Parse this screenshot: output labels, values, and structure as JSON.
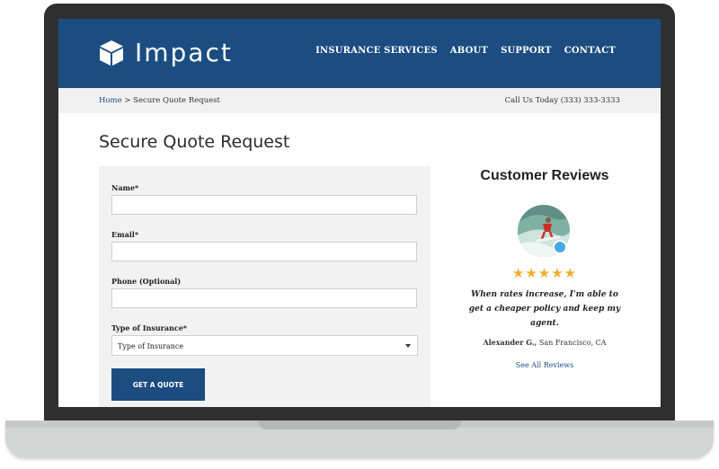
{
  "brand": {
    "name": "Impact"
  },
  "nav": {
    "items": [
      "INSURANCE SERVICES",
      "ABOUT",
      "SUPPORT",
      "CONTACT"
    ]
  },
  "breadcrumb": {
    "home": "Home",
    "separator": ">",
    "current": "Secure Quote Request"
  },
  "contact": {
    "phone_text": "Call Us Today (333) 333-3333"
  },
  "page": {
    "title": "Secure Quote Request"
  },
  "form": {
    "name_label": "Name*",
    "email_label": "Email*",
    "phone_label": "Phone (Optional)",
    "type_label": "Type of Insurance*",
    "type_value": "Type of Insurance",
    "submit_label": "GET A QUOTE"
  },
  "reviews": {
    "title": "Customer Reviews",
    "stars": "★★★★★",
    "rating": 5,
    "quote": "When rates increase, I'm able to get a cheaper policy and keep my agent.",
    "author_name": "Alexander G.,",
    "author_location": "San Francisco, CA",
    "see_all": "See All Reviews"
  },
  "colors": {
    "brand": "#1b4d81",
    "star": "#f0ad2e",
    "badge": "#4aa8e0",
    "form_bg": "#f2f2f2"
  },
  "icons": {
    "logo": "cube-icon",
    "select": "caret-down-icon",
    "badge": "verified-badge-icon"
  }
}
